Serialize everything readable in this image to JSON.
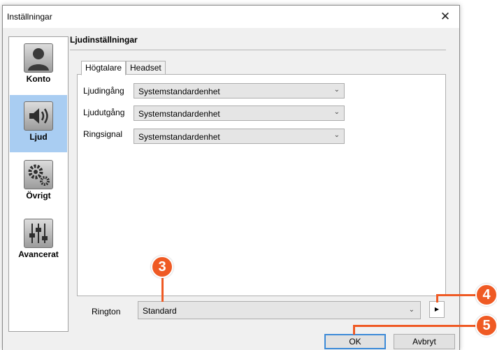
{
  "window": {
    "title": "Inställningar",
    "close_glyph": "✕"
  },
  "sidebar": {
    "items": [
      {
        "label": "Konto",
        "icon": "person-icon",
        "active": false
      },
      {
        "label": "Ljud",
        "icon": "speaker-icon",
        "active": true
      },
      {
        "label": "Övrigt",
        "icon": "gears-icon",
        "active": false
      },
      {
        "label": "Avancerat",
        "icon": "sliders-icon",
        "active": false
      }
    ]
  },
  "section": {
    "title": "Ljudinställningar"
  },
  "tabs": [
    {
      "label": "Högtalare",
      "active": true
    },
    {
      "label": "Headset",
      "active": false
    }
  ],
  "fields": [
    {
      "label": "Ljudingång",
      "value": "Systemstandardenhet"
    },
    {
      "label": "Ljudutgång",
      "value": "Systemstandardenhet"
    },
    {
      "label": "Ringsignal",
      "value": "Systemstandardenhet"
    }
  ],
  "ringtone": {
    "label": "Rington",
    "value": "Standard"
  },
  "buttons": {
    "ok": "OK",
    "cancel": "Avbryt"
  },
  "callouts": [
    "3",
    "4",
    "5"
  ],
  "colors": {
    "callout": "#ef5a24",
    "sidebar_active": "#a9cdf2"
  }
}
